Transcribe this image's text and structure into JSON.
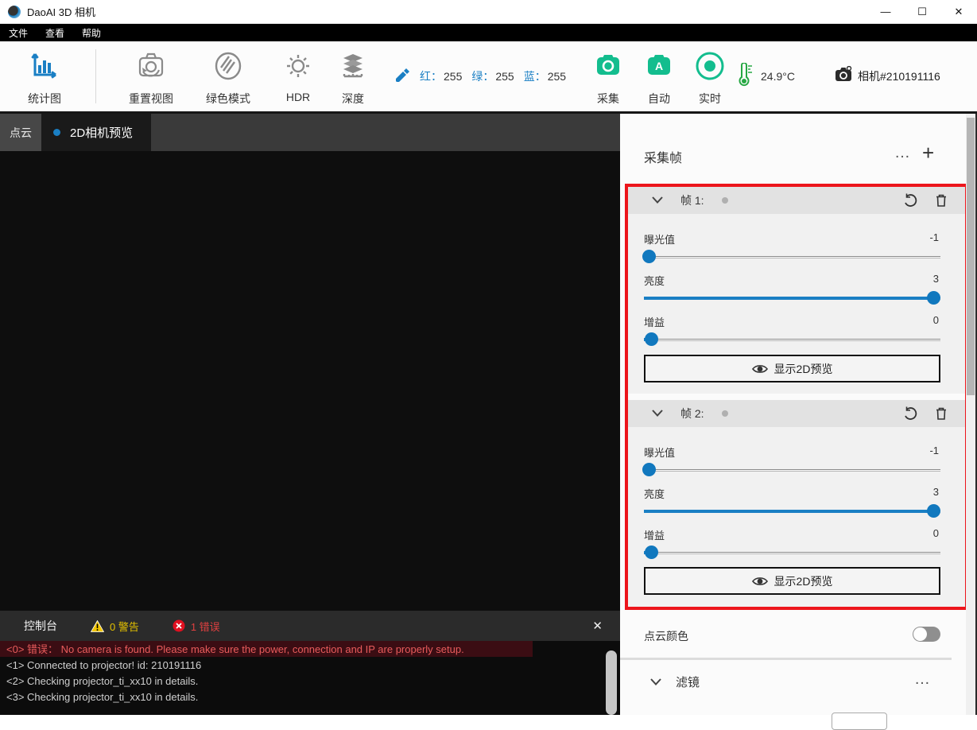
{
  "window": {
    "title": "DaoAI 3D 相机",
    "minimize": "—",
    "maximize": "☐",
    "close": "✕"
  },
  "menu": {
    "items": [
      "文件",
      "查看",
      "帮助"
    ]
  },
  "toolbar": {
    "stats": "统计图",
    "reset_view": "重置视图",
    "green_mode": "绿色模式",
    "hdr": "HDR",
    "depth": "深度",
    "picker": {
      "red_label": "红：",
      "red": "255",
      "green_label": "绿：",
      "green": "255",
      "blue_label": "蓝：",
      "blue": "255"
    },
    "capture": "采集",
    "auto": "自动",
    "live": "实时",
    "temperature": "24.9°C",
    "camera_id": "相机#210191116"
  },
  "tabs": {
    "pointcloud": "点云",
    "preview2d": "2D相机预览"
  },
  "panel": {
    "title": "采集帧",
    "more": "…",
    "add": "+",
    "frames": [
      {
        "title": "帧 1:",
        "controls": [
          {
            "label": "曝光值",
            "value": "-1",
            "percent": 1.5
          },
          {
            "label": "亮度",
            "value": "3",
            "percent": 97.5
          },
          {
            "label": "增益",
            "value": "0",
            "percent": 2.5
          }
        ],
        "preview_button": "显示2D预览"
      },
      {
        "title": "帧 2:",
        "controls": [
          {
            "label": "曝光值",
            "value": "-1",
            "percent": 1.5
          },
          {
            "label": "亮度",
            "value": "3",
            "percent": 97.5
          },
          {
            "label": "增益",
            "value": "0",
            "percent": 2.5
          }
        ],
        "preview_button": "显示2D预览"
      }
    ],
    "pointcloud_color": "点云颜色",
    "filter": {
      "title": "滤镜",
      "more": "…"
    }
  },
  "console": {
    "title": "控制台",
    "warnings": "0 警告",
    "errors": "1 错误",
    "close": "✕",
    "lines": [
      {
        "text": "<0> 错误：  No camera is found. Please make sure the power, connection and IP are properly setup.",
        "type": "error"
      },
      {
        "text": "<1> Connected to projector! id: 210191116",
        "type": "info"
      },
      {
        "text": "<2> Checking projector_ti_xx10 in details.",
        "type": "info"
      },
      {
        "text": "<3> Checking projector_ti_xx10 in details.",
        "type": "info"
      }
    ]
  },
  "colors": {
    "accent_blue": "#1a7fc4",
    "accent_green": "#13bd8e",
    "thermo_green": "#27a844",
    "red_border": "#ec151b",
    "error_red": "#e04040",
    "warning_yellow": "#e3c000"
  }
}
